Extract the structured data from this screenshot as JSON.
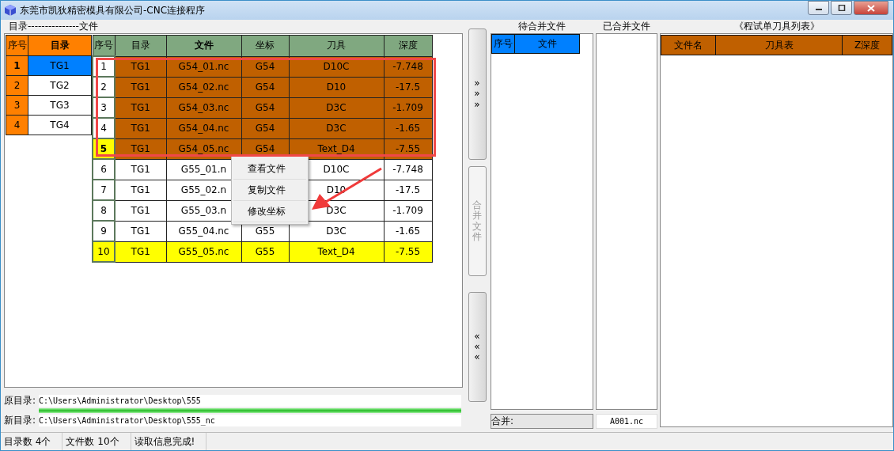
{
  "window": {
    "title": "东莞市凯狄精密模具有限公司-CNC连接程序"
  },
  "group_label": "目录---------------文件",
  "dir_table": {
    "columns": [
      {
        "label": "序号",
        "bold": false
      },
      {
        "label": "目录",
        "bold": true
      }
    ],
    "rows": [
      {
        "index": "1",
        "name": "TG1",
        "selected": true
      },
      {
        "index": "2",
        "name": "TG2",
        "selected": false
      },
      {
        "index": "3",
        "name": "TG3",
        "selected": false
      },
      {
        "index": "4",
        "name": "TG4",
        "selected": false
      }
    ]
  },
  "file_table": {
    "columns": [
      {
        "label": "序号",
        "bold": false
      },
      {
        "label": "目录",
        "bold": false
      },
      {
        "label": "文件",
        "bold": true
      },
      {
        "label": "坐标",
        "bold": false
      },
      {
        "label": "刀具",
        "bold": false
      },
      {
        "label": "深度",
        "bold": false
      }
    ],
    "rows": [
      {
        "index": "1",
        "dir": "TG1",
        "file": "G54_01.nc",
        "coord": "G54",
        "tool": "D10C",
        "depth": "-7.748",
        "selected": true,
        "current": false,
        "marked": false
      },
      {
        "index": "2",
        "dir": "TG1",
        "file": "G54_02.nc",
        "coord": "G54",
        "tool": "D10",
        "depth": "-17.5",
        "selected": true,
        "current": false,
        "marked": false
      },
      {
        "index": "3",
        "dir": "TG1",
        "file": "G54_03.nc",
        "coord": "G54",
        "tool": "D3C",
        "depth": "-1.709",
        "selected": true,
        "current": false,
        "marked": false
      },
      {
        "index": "4",
        "dir": "TG1",
        "file": "G54_04.nc",
        "coord": "G54",
        "tool": "D3C",
        "depth": "-1.65",
        "selected": true,
        "current": false,
        "marked": false
      },
      {
        "index": "5",
        "dir": "TG1",
        "file": "G54_05.nc",
        "coord": "G54",
        "tool": "Text_D4",
        "depth": "-7.55",
        "selected": true,
        "current": true,
        "marked": false
      },
      {
        "index": "6",
        "dir": "TG1",
        "file": "G55_01.n",
        "tool": "D10C",
        "depth": "-7.748",
        "selected": false,
        "current": false,
        "marked": false
      },
      {
        "index": "7",
        "dir": "TG1",
        "file": "G55_02.n",
        "tool": "D10",
        "depth": "-17.5",
        "selected": false,
        "current": false,
        "marked": false
      },
      {
        "index": "8",
        "dir": "TG1",
        "file": "G55_03.n",
        "tool": "D3C",
        "depth": "-1.709",
        "selected": false,
        "current": false,
        "marked": false
      },
      {
        "index": "9",
        "dir": "TG1",
        "file": "G55_04.nc",
        "coord": "G55",
        "tool": "D3C",
        "depth": "-1.65",
        "selected": false,
        "current": false,
        "marked": false
      },
      {
        "index": "10",
        "dir": "TG1",
        "file": "G55_05.nc",
        "coord": "G55",
        "tool": "Text_D4",
        "depth": "-7.55",
        "selected": false,
        "current": false,
        "marked": true
      }
    ]
  },
  "context_menu": {
    "items": [
      "查看文件",
      "复制文件",
      "修改坐标"
    ]
  },
  "annotations": {
    "box": true,
    "arrow": true
  },
  "side_buttons": [
    {
      "label": "»»»",
      "kind": "add",
      "disabled": false
    },
    {
      "label": "合并文件",
      "kind": "merge",
      "disabled": true
    },
    {
      "label": "«««",
      "kind": "remove",
      "disabled": false
    }
  ],
  "pending": {
    "title": "待合并文件",
    "columns": [
      "序号",
      "文件"
    ]
  },
  "merged": {
    "title": "已合并文件"
  },
  "tool_list": {
    "title": "《程试单刀具列表》",
    "columns": [
      "文件名",
      "刀具表",
      "Z深度"
    ]
  },
  "source_dir": {
    "label": "原目录:",
    "value": "C:\\Users\\Administrator\\Desktop\\555"
  },
  "progress": {
    "level": 1
  },
  "target_dir": {
    "label": "新目录:",
    "value": "C:\\Users\\Administrator\\Desktop\\555_nc"
  },
  "merge_field": {
    "label": "合并:"
  },
  "output_name": {
    "value": "A001.nc"
  },
  "status_bar": [
    "目录数 4个",
    "文件数 10个",
    "读取信息完成!"
  ]
}
